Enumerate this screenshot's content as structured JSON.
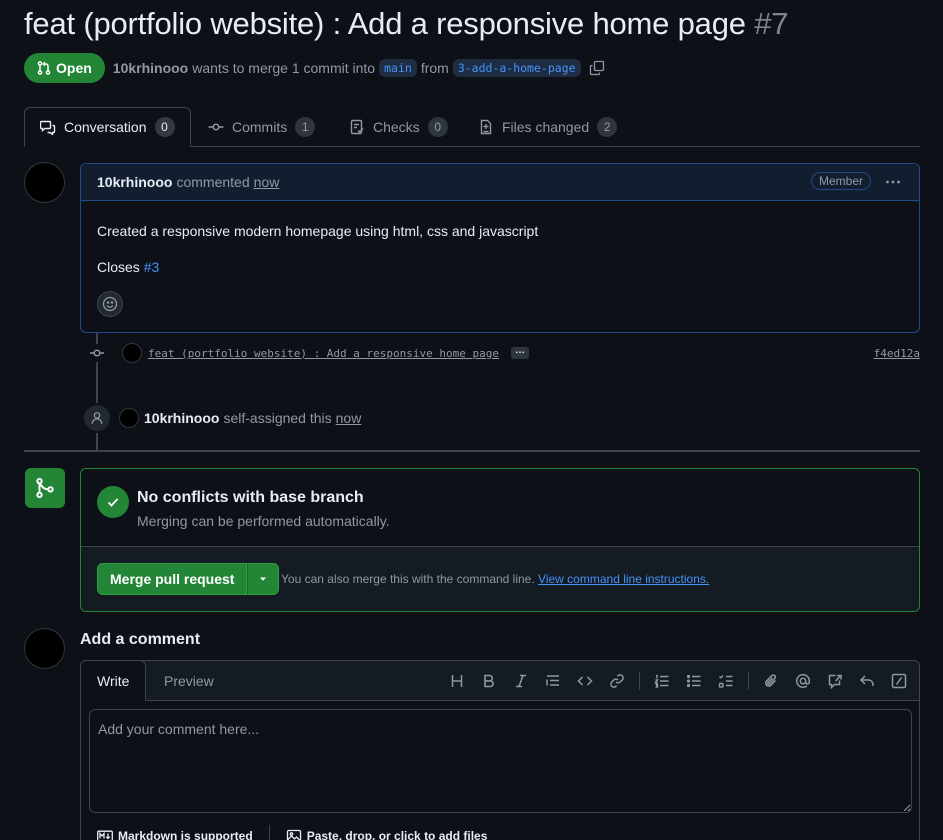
{
  "pr": {
    "title": "feat (portfolio website) : Add a responsive home page",
    "number": "#7",
    "state": "Open",
    "author": "10krhinooo",
    "merge_text": "wants to merge 1 commit into",
    "base_branch": "main",
    "from_text": "from",
    "head_branch": "3-add-a-home-page"
  },
  "tabs": [
    {
      "label": "Conversation",
      "count": "0"
    },
    {
      "label": "Commits",
      "count": "1"
    },
    {
      "label": "Checks",
      "count": "0"
    },
    {
      "label": "Files changed",
      "count": "2"
    }
  ],
  "comment": {
    "author": "10krhinooo",
    "action": "commented",
    "time": "now",
    "role": "Member",
    "body_line1": "Created a responsive modern homepage using html, css and javascript",
    "closes_text": "Closes",
    "closes_link": "#3"
  },
  "commit": {
    "message": "feat (portfolio website) : Add a responsive home page",
    "ellipsis": "…",
    "sha": "f4ed12a"
  },
  "assign": {
    "user": "10krhinooo",
    "action": "self-assigned this",
    "time": "now"
  },
  "merge": {
    "title": "No conflicts with base branch",
    "subtitle": "Merging can be performed automatically.",
    "button": "Merge pull request",
    "note": "You can also merge this with the command line.",
    "note_link": "View command line instructions."
  },
  "add_comment": {
    "title": "Add a comment",
    "tab_write": "Write",
    "tab_preview": "Preview",
    "placeholder": "Add your comment here...",
    "markdown_note": "Markdown is supported",
    "files_note": "Paste, drop, or click to add files"
  },
  "colors": {
    "background": "#0d1117",
    "accent_green": "#238636",
    "link_blue": "#4493f8",
    "muted": "#9198a1"
  }
}
